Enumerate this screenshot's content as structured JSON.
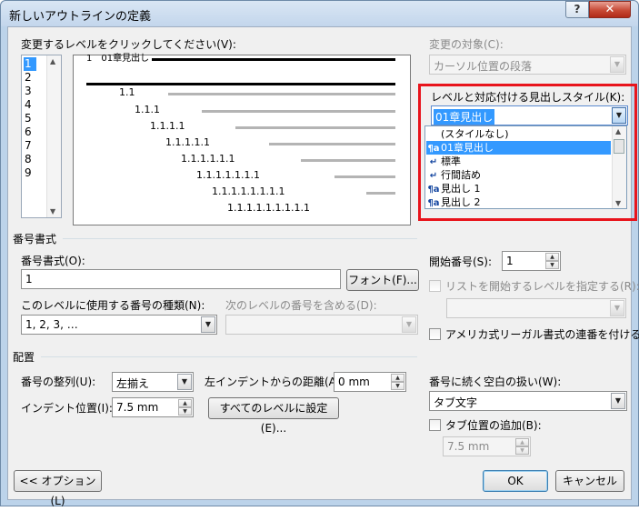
{
  "window": {
    "title": "新しいアウトラインの定義",
    "help": "?",
    "close": "✕"
  },
  "level_section": {
    "label": "変更するレベルをクリックしてください(V):",
    "levels": [
      "1",
      "2",
      "3",
      "4",
      "5",
      "6",
      "7",
      "8",
      "9"
    ],
    "selected": "1"
  },
  "preview": {
    "rows": [
      {
        "text": "1　01章見出し"
      },
      {
        "text": "1.1"
      },
      {
        "text": "1.1.1"
      },
      {
        "text": "1.1.1.1"
      },
      {
        "text": "1.1.1.1.1"
      },
      {
        "text": "1.1.1.1.1.1"
      },
      {
        "text": "1.1.1.1.1.1.1"
      },
      {
        "text": "1.1.1.1.1.1.1.1"
      },
      {
        "text": "1.1.1.1.1.1.1.1.1"
      }
    ]
  },
  "apply_target": {
    "label": "変更の対象(C):",
    "value": "カーソル位置の段落"
  },
  "linked_style": {
    "label": "レベルと対応付ける見出しスタイル(K):",
    "value": "01章見出し",
    "options": [
      {
        "icon": "",
        "label": "(スタイルなし)"
      },
      {
        "icon": "¶a",
        "label": "01章見出し"
      },
      {
        "icon": "↵",
        "label": "標準"
      },
      {
        "icon": "↵",
        "label": "行間詰め"
      },
      {
        "icon": "¶a",
        "label": "見出し 1"
      },
      {
        "icon": "¶a",
        "label": "見出し 2"
      }
    ],
    "highlight_color": "#e8141c"
  },
  "number_format": {
    "group_label": "番号書式",
    "format_label": "番号書式(O):",
    "format_value": "1",
    "font_button": "フォント(F)...",
    "style_label": "このレベルに使用する番号の種類(N):",
    "style_value": "1, 2, 3, …",
    "include_label": "次のレベルの番号を含める(D):",
    "include_value": ""
  },
  "start": {
    "label": "開始番号(S):",
    "value": "1",
    "restart_label": "リストを開始するレベルを指定する(R):",
    "restart_value": "",
    "legal_label": "アメリカ式リーガル書式の連番を付ける(G)"
  },
  "placement": {
    "group_label": "配置",
    "align_label": "番号の整列(U):",
    "align_value": "左揃え",
    "aligned_at_label": "左インデントからの距離(A):",
    "aligned_at_value": "0 mm",
    "indent_label": "インデント位置(I):",
    "indent_value": "7.5 mm",
    "set_all_button": "すべてのレベルに設定(E)...",
    "follow_label": "番号に続く空白の扱い(W):",
    "follow_value": "タブ文字",
    "tab_label": "タブ位置の追加(B):",
    "tab_value": "7.5 mm"
  },
  "footer": {
    "options_button": "<< オプション(L)",
    "ok_button": "OK",
    "cancel_button": "キャンセル"
  }
}
